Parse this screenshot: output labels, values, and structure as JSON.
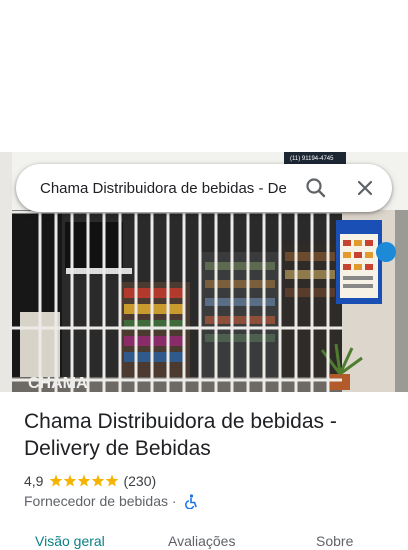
{
  "search": {
    "query": "Chama Distribuidora de bebidas - Delivery de Bebidas",
    "search_icon": "search-icon",
    "close_icon": "close-icon"
  },
  "photo": {
    "description_icon": "storefront-photo",
    "sign_text": "CHAMA",
    "top_number": "(11) 91194-4745"
  },
  "place": {
    "title": "Chama Distribuidora de bebidas - Delivery de Bebidas",
    "rating": "4,9",
    "stars": 5,
    "review_count": "(230)",
    "category": "Fornecedor de bebidas",
    "separator": "·",
    "accessibility_icon": "wheelchair-icon"
  },
  "tabs": [
    {
      "label": "Visão geral",
      "active": true
    },
    {
      "label": "Avaliações",
      "active": false
    },
    {
      "label": "Sobre",
      "active": false
    }
  ],
  "colors": {
    "star": "#f5b400",
    "accent": "#0b7f86",
    "accessibility": "#1a73e8"
  }
}
